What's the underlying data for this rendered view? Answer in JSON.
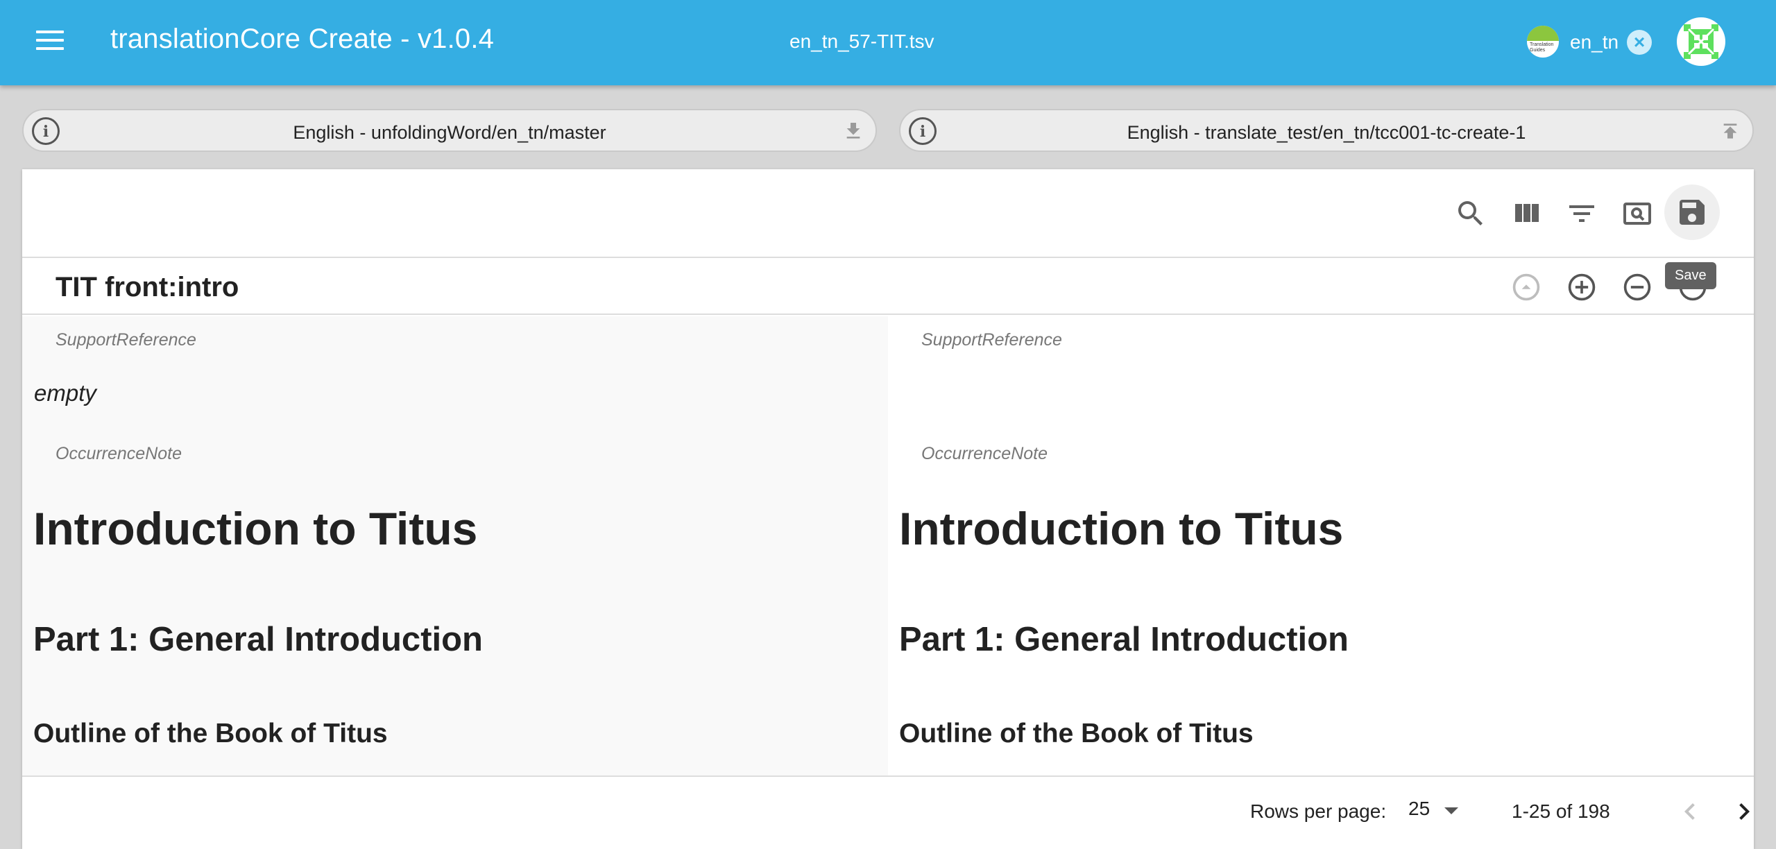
{
  "appbar": {
    "title": "translationCore Create - v1.0.4",
    "file": "en_tn_57-TIT.tsv",
    "org_logo_text": "Translation Guides",
    "language": "en_tn",
    "close_glyph": "×",
    "bg_color": "#35aee3"
  },
  "resources": {
    "source": {
      "label": "English - unfoldingWord/en_tn/master",
      "info_glyph": "i",
      "action_icon": "download-icon"
    },
    "target": {
      "label": "English - translate_test/en_tn/tcc001-tc-create-1",
      "info_glyph": "i",
      "action_icon": "upload-icon"
    }
  },
  "toolbar": {
    "icons": [
      "search-icon",
      "view-columns-icon",
      "filter-icon",
      "preview-icon",
      "save-icon"
    ],
    "tooltip": "Save"
  },
  "row": {
    "title": "TIT front:intro",
    "icons": [
      "expand-up-icon",
      "add-row-icon",
      "remove-row-icon",
      "more-icon"
    ]
  },
  "source": {
    "support_reference_label": "SupportReference",
    "support_reference_value": "empty",
    "occurrence_note_label": "OccurrenceNote",
    "heading1": "Introduction to Titus",
    "heading2": "Part 1: General Introduction",
    "heading3": "Outline of the Book of Titus"
  },
  "target": {
    "support_reference_label": "SupportReference",
    "occurrence_note_label": "OccurrenceNote",
    "heading1": "Introduction to Titus",
    "heading2": "Part 1: General Introduction",
    "heading3": "Outline of the Book of Titus"
  },
  "pagination": {
    "rows_per_page_label": "Rows per page:",
    "rows_per_page": "25",
    "range": "1-25 of 198"
  }
}
